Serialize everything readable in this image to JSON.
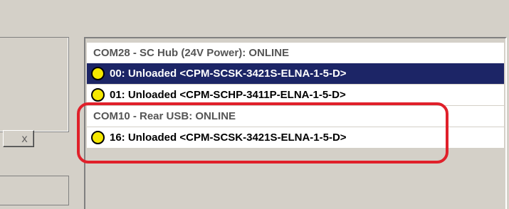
{
  "left": {
    "button_label": "x"
  },
  "device_list": {
    "rows": [
      {
        "kind": "group",
        "label": "COM28 - SC Hub (24V Power):  ONLINE"
      },
      {
        "kind": "node",
        "label": "00: Unloaded <CPM-SCSK-3421S-ELNA-1-5-D>",
        "selected": true,
        "led_icon": "yellow-status-led-icon"
      },
      {
        "kind": "node",
        "label": "01: Unloaded <CPM-SCHP-3411P-ELNA-1-5-D>",
        "selected": false,
        "led_icon": "yellow-status-led-icon"
      },
      {
        "kind": "group",
        "label": "COM10 - Rear USB:  ONLINE"
      },
      {
        "kind": "node",
        "label": "16: Unloaded <CPM-SCSK-3421S-ELNA-1-5-D>",
        "selected": false,
        "led_icon": "yellow-status-led-icon"
      }
    ]
  },
  "colors": {
    "selection": "#1c2566",
    "led": "#f5e800",
    "highlight": "#e0202a"
  }
}
